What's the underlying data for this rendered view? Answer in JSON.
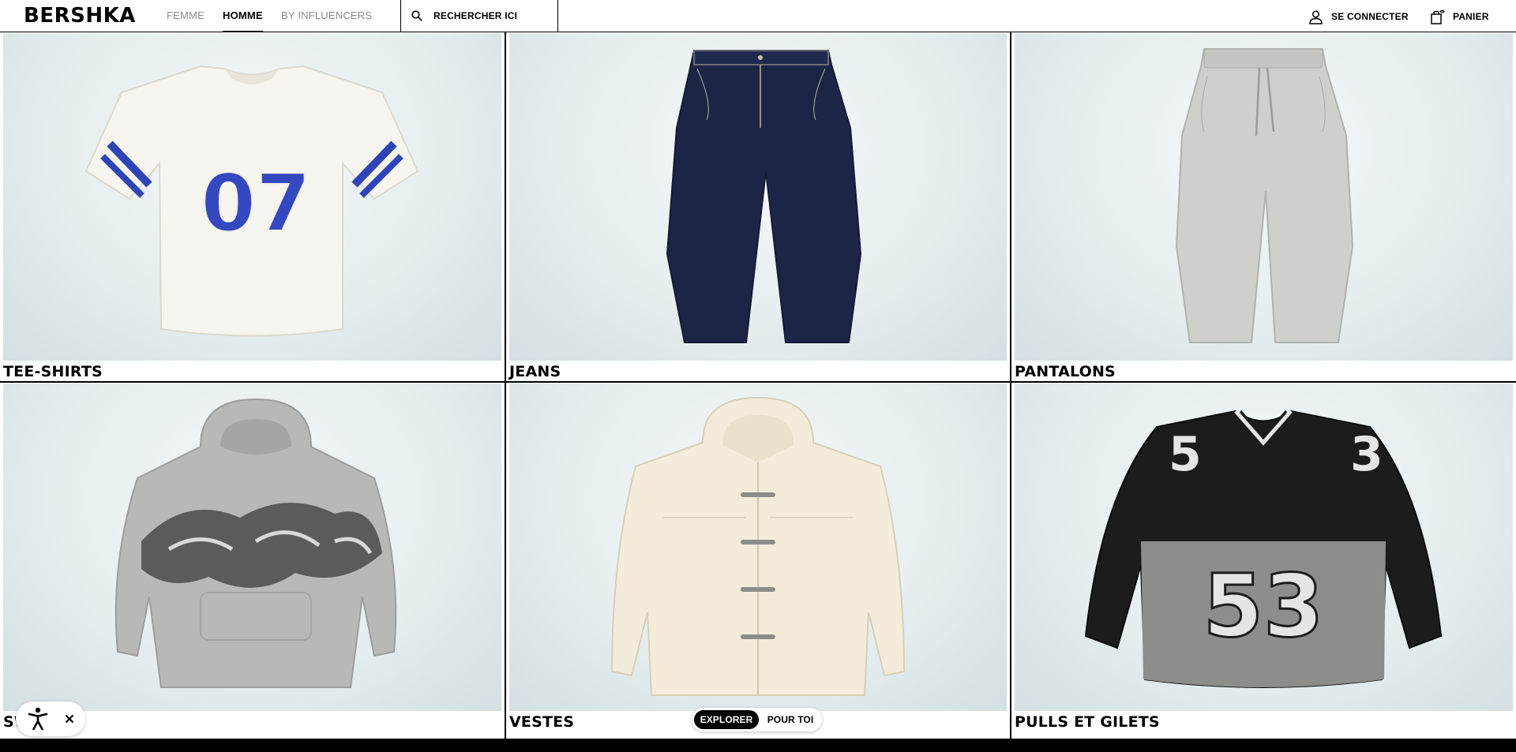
{
  "header": {
    "logo": "BERSHKA",
    "tabs": [
      {
        "label": "FEMME",
        "active": false
      },
      {
        "label": "HOMME",
        "active": true
      },
      {
        "label": "BY INFLUENCERS",
        "active": false
      }
    ],
    "search": {
      "label": "RECHERCHER ICI",
      "icon": "search-icon"
    },
    "login": {
      "label": "SE CONNECTER",
      "icon": "user-icon"
    },
    "cart": {
      "label": "PANIER",
      "icon": "shopping-bag-icon"
    }
  },
  "categories": [
    {
      "label": "TEE-SHIRTS",
      "image": "white-mesh-football-tee-07"
    },
    {
      "label": "JEANS",
      "image": "dark-denim-balloon-jeans"
    },
    {
      "label": "PANTALONS",
      "image": "grey-jogger-pants"
    },
    {
      "label": "SW",
      "image": "grey-graffiti-hoodie"
    },
    {
      "label": "VESTES",
      "image": "cream-hooded-toggle-jacket"
    },
    {
      "label": "PULLS ET GILETS",
      "image": "black-grey-knit-sweater-53"
    }
  ],
  "accessibility_widget": {
    "icon": "accessibility-icon",
    "close_icon": "close-icon"
  },
  "feed_toggle": {
    "options": [
      {
        "label": "EXPLORER",
        "active": true
      },
      {
        "label": "POUR TOI",
        "active": false
      }
    ]
  },
  "colors": {
    "accent": "#000000",
    "background": "#ffffff",
    "inactive_text": "#8a8a8a",
    "photo_backdrop": "#e6eef0"
  }
}
